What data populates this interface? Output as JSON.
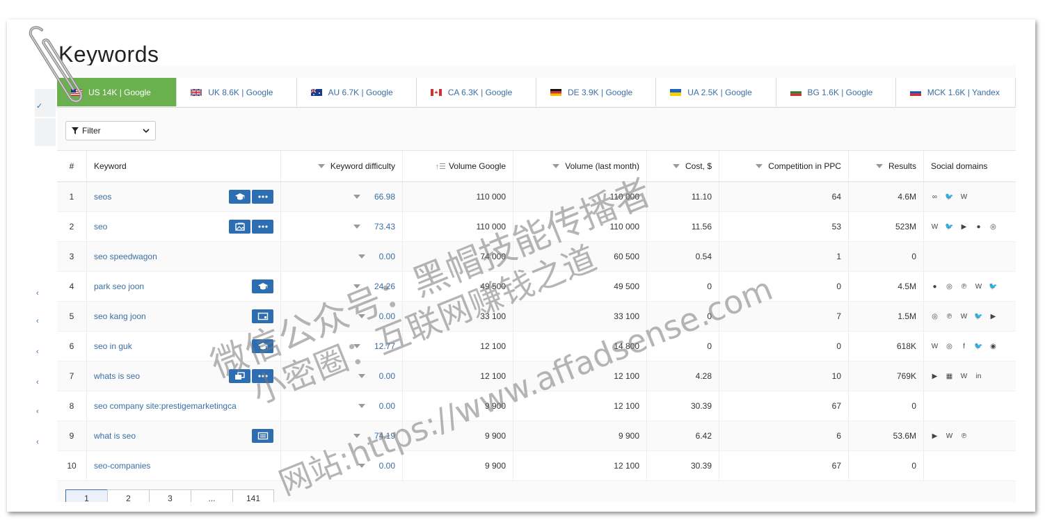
{
  "page": {
    "title": "Keywords"
  },
  "tabs": [
    {
      "label": "US 14K | Google",
      "flag": "us",
      "active": true
    },
    {
      "label": "UK 8.6K | Google",
      "flag": "uk",
      "active": false
    },
    {
      "label": "AU 6.7K | Google",
      "flag": "au",
      "active": false
    },
    {
      "label": "CA 6.3K | Google",
      "flag": "ca",
      "active": false
    },
    {
      "label": "DE 3.9K | Google",
      "flag": "de",
      "active": false
    },
    {
      "label": "UA 2.5K | Google",
      "flag": "ua",
      "active": false
    },
    {
      "label": "BG 1.6K | Google",
      "flag": "bg",
      "active": false
    },
    {
      "label": "MCK 1.6K | Yandex",
      "flag": "ru",
      "active": false
    }
  ],
  "filter": {
    "label": "Filter"
  },
  "table": {
    "headers": {
      "num": "#",
      "keyword": "Keyword",
      "difficulty": "Keyword difficulty",
      "volume_google": "Volume Google",
      "volume_last": "Volume (last month)",
      "cost": "Cost, $",
      "competition": "Competition in PPC",
      "results": "Results",
      "social": "Social domains"
    },
    "rows": [
      {
        "num": "1",
        "keyword": "seos",
        "difficulty": "66.98",
        "volume_google": "110 000",
        "volume_last": "110 000",
        "cost": "11.10",
        "competition": "64",
        "results": "4.6M",
        "buttons": [
          "grad-cap-icon",
          "more-icon"
        ],
        "social": [
          "tripadvisor-icon",
          "twitter-icon",
          "wikipedia-icon"
        ]
      },
      {
        "num": "2",
        "keyword": "seo",
        "difficulty": "73.43",
        "volume_google": "110 000",
        "volume_last": "110 000",
        "cost": "11.56",
        "competition": "53",
        "results": "523M",
        "buttons": [
          "image-pack-icon",
          "more-icon"
        ],
        "social": [
          "wikipedia-icon",
          "twitter-icon",
          "youtube-icon",
          "reddit-icon",
          "instagram-icon"
        ]
      },
      {
        "num": "3",
        "keyword": "seo speedwagon",
        "difficulty": "0.00",
        "volume_google": "74 000",
        "volume_last": "60 500",
        "cost": "0.54",
        "competition": "1",
        "results": "0",
        "buttons": [],
        "social": []
      },
      {
        "num": "4",
        "keyword": "park seo joon",
        "difficulty": "24.26",
        "volume_google": "49 500",
        "volume_last": "49 500",
        "cost": "0",
        "competition": "0",
        "results": "4.5M",
        "buttons": [
          "grad-cap-icon"
        ],
        "social": [
          "reddit-icon",
          "instagram-icon",
          "pinterest-icon",
          "wikipedia-icon",
          "twitter-icon"
        ]
      },
      {
        "num": "5",
        "keyword": "seo kang joon",
        "difficulty": "0.00",
        "volume_google": "33 100",
        "volume_last": "33 100",
        "cost": "0",
        "competition": "7",
        "results": "1.5M",
        "buttons": [
          "video-icon"
        ],
        "social": [
          "instagram-icon",
          "pinterest-icon",
          "wikipedia-icon",
          "twitter-icon",
          "youtube-icon"
        ]
      },
      {
        "num": "6",
        "keyword": "seo in guk",
        "difficulty": "12.77",
        "volume_google": "12 100",
        "volume_last": "14 800",
        "cost": "0",
        "competition": "0",
        "results": "618K",
        "buttons": [
          "grad-cap-icon"
        ],
        "social": [
          "wikipedia-icon",
          "instagram-icon",
          "facebook-icon",
          "twitter-icon",
          "spotify-icon"
        ]
      },
      {
        "num": "7",
        "keyword": "whats is seo",
        "difficulty": "0.00",
        "volume_google": "12 100",
        "volume_last": "12 100",
        "cost": "4.28",
        "competition": "10",
        "results": "769K",
        "buttons": [
          "copy-icon",
          "more-icon"
        ],
        "social": [
          "youtube-icon",
          "store-icon",
          "wikipedia-icon",
          "linkedin-icon"
        ]
      },
      {
        "num": "8",
        "keyword": "seo company site:prestigemarketingca",
        "difficulty": "0.00",
        "volume_google": "9 900",
        "volume_last": "12 100",
        "cost": "30.39",
        "competition": "67",
        "results": "0",
        "buttons": [],
        "social": []
      },
      {
        "num": "9",
        "keyword": "what is seo",
        "difficulty": "74.19",
        "volume_google": "9 900",
        "volume_last": "9 900",
        "cost": "6.42",
        "competition": "6",
        "results": "53.6M",
        "buttons": [
          "snippet-icon"
        ],
        "social": [
          "youtube-icon",
          "wikipedia-icon",
          "pinterest-icon"
        ]
      },
      {
        "num": "10",
        "keyword": "seo-companies",
        "difficulty": "0.00",
        "volume_google": "9 900",
        "volume_last": "12 100",
        "cost": "30.39",
        "competition": "67",
        "results": "0",
        "buttons": [],
        "social": []
      }
    ]
  },
  "pagination": {
    "pages": [
      "1",
      "2",
      "3",
      "...",
      "141"
    ],
    "current": "1"
  },
  "watermark": {
    "line1": "微信公众号：黑帽技能传播者",
    "line2": "小密圈：互联网赚钱之道",
    "line3": "网站:https://www.affadsense.com"
  },
  "colors": {
    "accent": "#6ab04c",
    "link": "#3a6ea5",
    "button": "#2d6eb3"
  }
}
